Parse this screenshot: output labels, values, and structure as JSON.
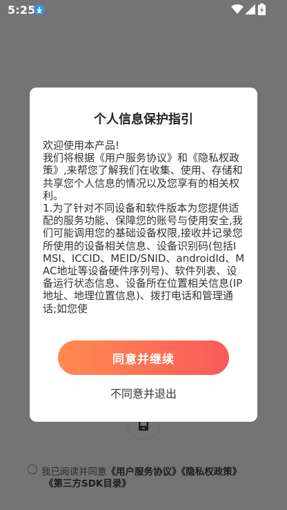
{
  "status_bar": {
    "time": "5:25",
    "icons": [
      "download-icon",
      "wifi-icon",
      "signal-icon",
      "battery-icon"
    ]
  },
  "dialog": {
    "title": "个人信息保护指引",
    "body_greeting": "欢迎使用本产品!",
    "body_para1": "我们将根据《用户服务协议》和《隐私权政策》,来帮您了解我们在收集、使用、存储和共享您个人信息的情况以及您享有的相关权利。",
    "body_para2": "1.为了针对不同设备和软件版本为您提供适配的服务功能、保障您的账号与使用安全,我们可能调用您的基础设备权限,接收并记录您所使用的设备相关信息、设备识别码(包括IMSI、ICCID、MEID/SNID、androidId、MAC地址等设备硬件序列号)、软件列表、设备运行状态信息、设备所在位置相关信息(IP地址、地理位置信息)、拨打电话和管理通话;如您使",
    "agree_label": "同意并继续",
    "disagree_label": "不同意并退出"
  },
  "background": {
    "agree_prefix": "我已阅读并同意",
    "link_service": "《用户服务协议》",
    "link_privacy": "《隐私权政策》",
    "link_sdk": "《第三方SDK目录》"
  },
  "colors": {
    "overlay": "#747474",
    "button_gradient_start": "#ff8a50",
    "button_gradient_end": "#fa5a5a"
  }
}
